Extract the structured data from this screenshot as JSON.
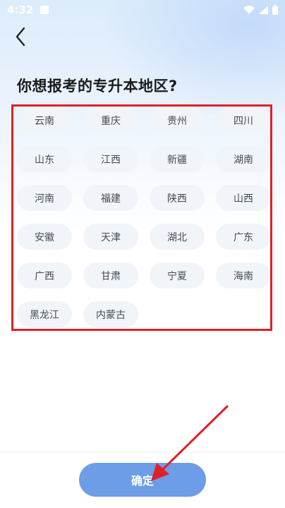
{
  "status_bar": {
    "time": "4:32"
  },
  "header": {
    "back_icon": "chevron-left-icon",
    "title": "你想报考的专升本地区?"
  },
  "regions": [
    "云南",
    "重庆",
    "贵州",
    "四川",
    "山东",
    "江西",
    "新疆",
    "湖南",
    "河南",
    "福建",
    "陕西",
    "山西",
    "安徽",
    "天津",
    "湖北",
    "广东",
    "广西",
    "甘肃",
    "宁夏",
    "海南",
    "黑龙江",
    "内蒙古"
  ],
  "footer": {
    "confirm_label": "确定"
  },
  "colors": {
    "accent": "#6d9de6",
    "highlight": "#e02027",
    "chip_bg": "#f1f5fa"
  }
}
